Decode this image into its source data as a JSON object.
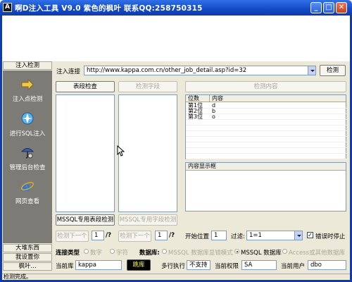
{
  "window": {
    "title": "啊D注入工具 V9.0 紫色的枫叶 联系QQ:258750315",
    "icon_letter": "A"
  },
  "nav": {
    "top_header": "注入检测",
    "items": [
      {
        "label": "注入点检测",
        "icon": "arrow-icon"
      },
      {
        "label": "进行SQL注入",
        "icon": "sql-injection-icon"
      },
      {
        "label": "管理后台检查",
        "icon": "admin-check-icon"
      },
      {
        "label": "网页查看",
        "icon": "ie-browser-icon"
      }
    ],
    "bottom_headers": [
      "大堆东西",
      "我设置你",
      "枫叶..."
    ]
  },
  "url_bar": {
    "label": "注入连接",
    "value": "http://www.kappa.com.cn/other_job_detail.asp?id=32",
    "detect_button": "检测"
  },
  "buttons": {
    "table_check": "表段检查",
    "field_check": "检测字段",
    "content_check": "检测内容",
    "mssql_table": "MSSQL专用表段检测",
    "mssql_field": "MSSQL专用字段检测",
    "detect_next_1": "检测下一个",
    "detect_next_2": "检测下一个"
  },
  "pager": {
    "page1": "1",
    "sep1": "/?",
    "page2": "1",
    "sep2": "/?"
  },
  "result_table": {
    "columns": [
      "位数",
      "内容"
    ],
    "rows": [
      {
        "pos": "第1位",
        "content": "d"
      },
      {
        "pos": "第2位",
        "content": "b"
      },
      {
        "pos": "第3位",
        "content": "o"
      }
    ]
  },
  "content_display": {
    "label": "内容显示框"
  },
  "filter": {
    "start_label": "开始位置",
    "start_value": "1",
    "filter_label": "过滤:",
    "filter_value": "1=1",
    "error_stop_label": "错误时停止",
    "error_stop_checked": true
  },
  "connection": {
    "type_label": "连接类型",
    "type_options": [
      "数字",
      "字符"
    ],
    "db_label": "数据库:",
    "db_options": [
      "MSSQL 数据库显错模式",
      "MSSQL 数据库",
      "Access或其他数据库"
    ],
    "db_selected": "MSSQL 数据库"
  },
  "info": {
    "current_db_label": "当前库",
    "current_db_value": "kappa",
    "jump_button": "跳库",
    "multi_exec_label": "多行执行",
    "multi_exec_value": "不支持",
    "perm_label": "当前权限",
    "perm_value": "SA",
    "user_label": "当前用户",
    "user_value": "dbo"
  },
  "status": {
    "text": "检测完成。"
  },
  "colors": {
    "titlebar": "#1448c4",
    "client": "#ece9d8",
    "nav_panel": "#7d7b76",
    "jump_button_bg": "#000000",
    "jump_button_fg": "#ffff00"
  }
}
